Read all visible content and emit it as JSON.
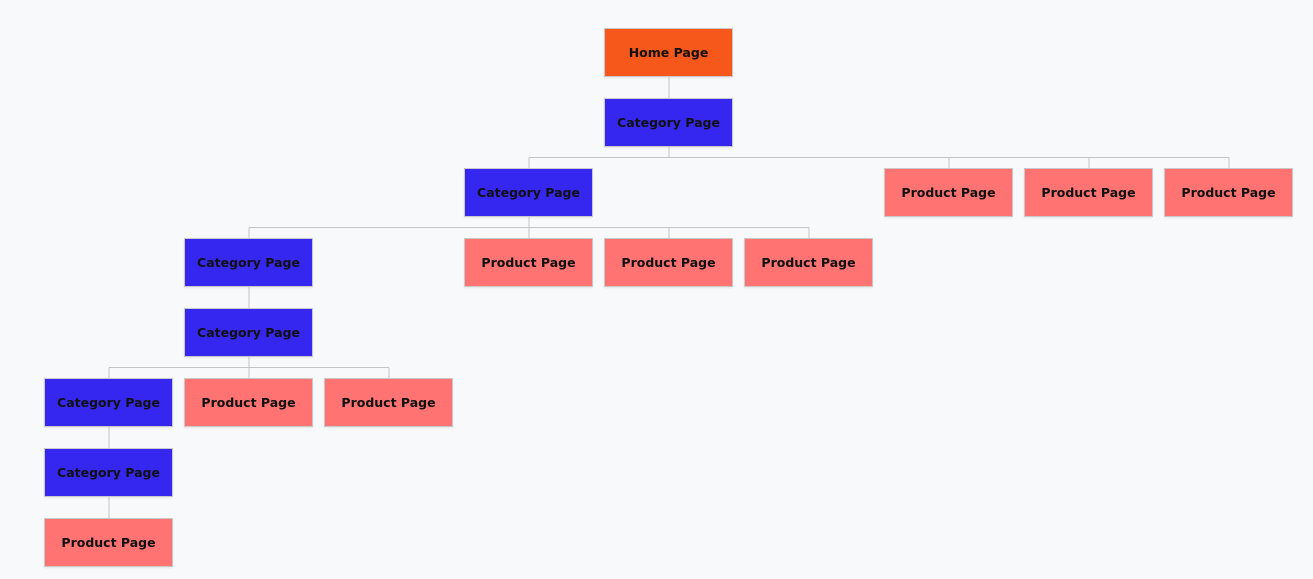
{
  "colors": {
    "home": "#f5581a",
    "category": "#3527f0",
    "product": "#ff7373",
    "connector": "#c4c4c4",
    "background": "#f8f9fb"
  },
  "nodes": [
    {
      "label": "Home Page",
      "type": "home",
      "parent": null
    },
    {
      "label": "Category Page",
      "type": "category",
      "parent": 0
    },
    {
      "label": "Category Page",
      "type": "category",
      "parent": 1
    },
    {
      "label": "Product Page",
      "type": "product",
      "parent": 1
    },
    {
      "label": "Product Page",
      "type": "product",
      "parent": 1
    },
    {
      "label": "Product Page",
      "type": "product",
      "parent": 1
    },
    {
      "label": "Category Page",
      "type": "category",
      "parent": 2
    },
    {
      "label": "Product Page",
      "type": "product",
      "parent": 2
    },
    {
      "label": "Product Page",
      "type": "product",
      "parent": 2
    },
    {
      "label": "Product Page",
      "type": "product",
      "parent": 2
    },
    {
      "label": "Category Page",
      "type": "category",
      "parent": 6
    },
    {
      "label": "Category Page",
      "type": "category",
      "parent": 10
    },
    {
      "label": "Product Page",
      "type": "product",
      "parent": 10
    },
    {
      "label": "Product Page",
      "type": "product",
      "parent": 10
    },
    {
      "label": "Category Page",
      "type": "category",
      "parent": 11
    },
    {
      "label": "Product Page",
      "type": "product",
      "parent": 14
    }
  ]
}
